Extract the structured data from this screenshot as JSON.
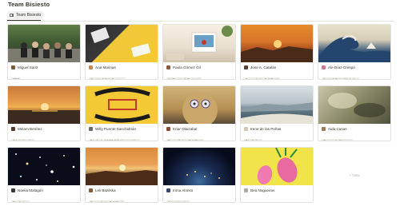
{
  "page": {
    "title": "Team Bisiesto"
  },
  "tabs": [
    {
      "label": "Team Bisiesto",
      "icon": "gallery-view-icon"
    }
  ],
  "members": [
    {
      "name": "Miguel Sanz",
      "role": "CEO",
      "avatar_color": "#7b5a3a"
    },
    {
      "name": "Ana Marinas",
      "role": "Graphic & Web Designer",
      "avatar_color": "#c48a4a"
    },
    {
      "name": "Paula Gómez Gil",
      "role": "Art Director & Strategist",
      "avatar_color": "#8a5a3a"
    },
    {
      "name": "Jose A. Catalán",
      "role": "Desarrollador Full-Stack",
      "avatar_color": "#5a4030"
    },
    {
      "name": "Ale Díaz-Crespo",
      "role": "Social & Digital Marketing",
      "avatar_color": "#c87a9a"
    },
    {
      "name": "Miriam Benítez",
      "role": "Administración",
      "avatar_color": "#5a3a2a"
    },
    {
      "name": "Willy Puente Sanchidrián",
      "role": "Diseñador UX/UI & Motion graphics",
      "avatar_color": "#6a6a6a"
    },
    {
      "name": "Itziar Olaizabal",
      "role": "Desarrolladora Full-Stack",
      "avatar_color": "#8a4a3a"
    },
    {
      "name": "Irene de las Peñas",
      "role": "Diseñadora",
      "avatar_color": "#d7c7b0"
    },
    {
      "name": "Aida Casas",
      "role": "Community Manager",
      "avatar_color": "#9a7a5a"
    },
    {
      "name": "Noelia Malagón",
      "role": "Diseñadora",
      "avatar_color": "#3a3a3a"
    },
    {
      "name": "Leli Bazilska",
      "role": "Desarrollador Full-Stack",
      "avatar_color": "#8a5a3a"
    },
    {
      "name": "Inma Alonso",
      "role": "Administración",
      "avatar_color": "#3a4a6a"
    },
    {
      "name": "Bea Nogueiras",
      "role": "",
      "avatar_color": "#b0aaa0"
    }
  ],
  "new_card": {
    "label": "+ New"
  }
}
